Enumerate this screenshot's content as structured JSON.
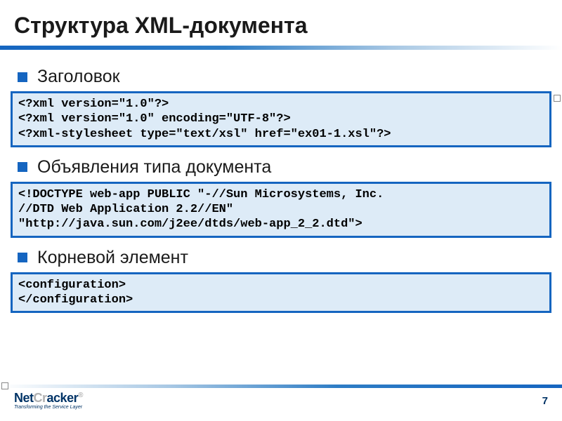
{
  "title": "Структура XML-документа",
  "sections": [
    {
      "label": "Заголовок",
      "code": "<?xml version=\"1.0\"?>\n<?xml version=\"1.0\" encoding=\"UTF-8\"?>\n<?xml-stylesheet type=\"text/xsl\" href=\"ex01-1.xsl\"?>"
    },
    {
      "label": "Объявления типа документа",
      "code": "<!DOCTYPE web-app PUBLIC \"-//Sun Microsystems, Inc.\n//DTD Web Application 2.2//EN\"\n\"http://java.sun.com/j2ee/dtds/web-app_2_2.dtd\">"
    },
    {
      "label": "Корневой элемент",
      "code": "<configuration>\n</configuration>"
    }
  ],
  "footer": {
    "logo": {
      "pre": "Net",
      "mid": "Cr",
      "post": "acker",
      "reg": "®",
      "tagline": "Transforming the Service Layer"
    },
    "page_number": "7"
  }
}
